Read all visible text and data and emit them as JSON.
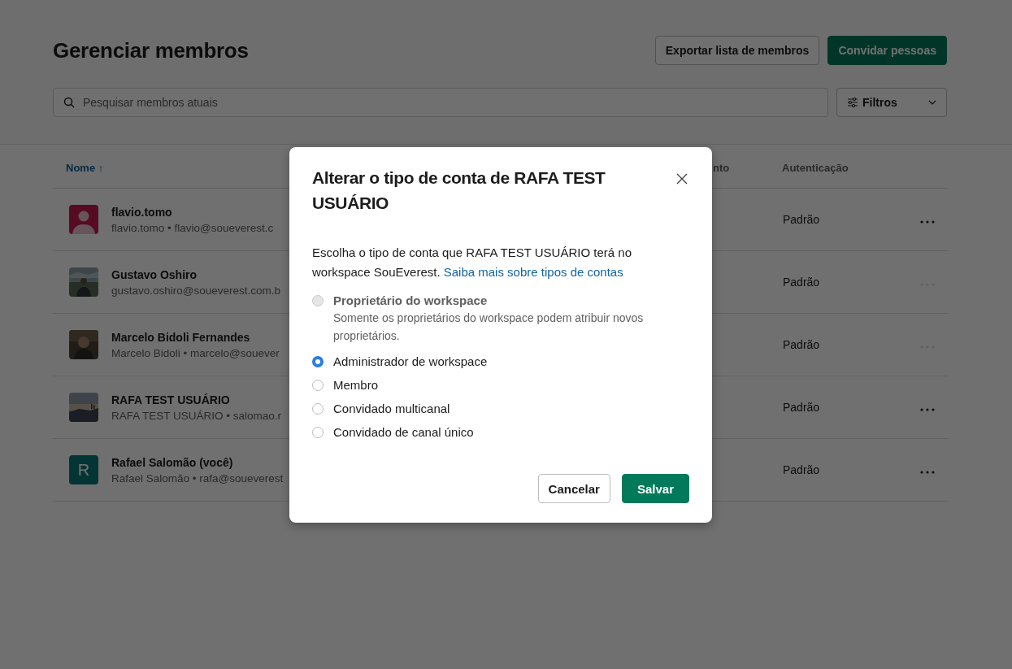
{
  "page": {
    "title": "Gerenciar membros",
    "buttons": [
      {
        "label": "Exportar lista de membros",
        "kind": "secondary"
      },
      {
        "label": "Convidar pessoas",
        "kind": "primary"
      }
    ],
    "search": {
      "placeholder": "Pesquisar membros atuais"
    },
    "filter": {
      "label": "Filtros"
    }
  },
  "table": {
    "columns": [
      {
        "label": "Nome ↑",
        "sorted": true
      },
      {
        "label": "nto",
        "sorted": false
      },
      {
        "label": "Autenticação",
        "sorted": false
      }
    ],
    "rows": [
      {
        "name": "flavio.tomo",
        "detail": "flavio.tomo • flavio@soueverest.c",
        "avatar": {
          "kind": "default"
        },
        "auth": "Padrão",
        "menu_disabled": false
      },
      {
        "name": "Gustavo Oshiro",
        "detail": "gustavo.oshiro@soueverest.com.b",
        "auth": "Padrão",
        "menu_disabled": true
      },
      {
        "name": "Marcelo Bidoli Fernandes",
        "detail": "Marcelo Bidoli • marcelo@souever",
        "auth": "Padrão",
        "menu_disabled": true
      },
      {
        "name": "RAFA TEST USUÁRIO",
        "detail": "RAFA TEST USUÁRIO • salomao.r",
        "auth": "Padrão",
        "menu_disabled": false
      },
      {
        "name": "Rafael Salomão (você)",
        "detail": "Rafael Salomão • rafa@soueverest",
        "avatar": {
          "kind": "letter",
          "letter": "R"
        },
        "auth": "Padrão",
        "menu_disabled": false
      }
    ]
  },
  "dialog": {
    "title": "Alterar o tipo de conta de RAFA TEST USUÁRIO",
    "text": "Escolha o tipo de conta que RAFA TEST USUÁRIO terá no workspace SouEverest.",
    "link": "Saiba mais sobre tipos de contas",
    "options": [
      {
        "label": "Proprietário do workspace",
        "description": "Somente os proprietários do workspace podem atribuir novos proprietários.",
        "selected": false,
        "disabled": true
      },
      {
        "label": "Administrador de workspace",
        "selected": true,
        "disabled": false
      },
      {
        "label": "Membro",
        "selected": false,
        "disabled": false
      },
      {
        "label": "Convidado multicanal",
        "selected": false,
        "disabled": false
      },
      {
        "label": "Convidado de canal único",
        "selected": false,
        "disabled": false
      }
    ],
    "buttons": [
      {
        "label": "Cancelar",
        "kind": "secondary"
      },
      {
        "label": "Salvar",
        "kind": "primary"
      }
    ]
  }
}
